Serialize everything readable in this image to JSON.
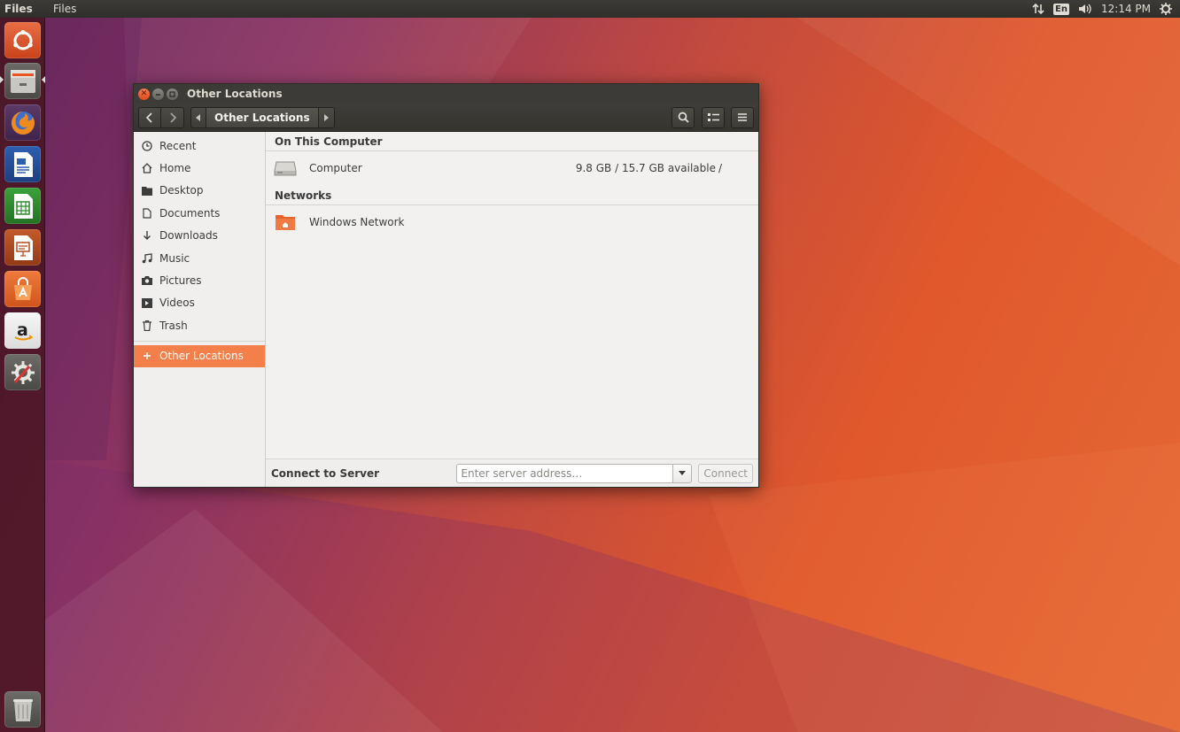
{
  "top_panel": {
    "app_name": "Files",
    "menu": "Files",
    "keyboard_layout": "En",
    "clock": "12:14 PM",
    "icons": [
      "network-transfer-icon",
      "keyboard-layout-icon",
      "volume-icon",
      "system-gear-icon"
    ]
  },
  "launcher": {
    "items": [
      {
        "name": "ubuntu-dash",
        "icon": "ubuntu-logo-icon",
        "color": "#e95420"
      },
      {
        "name": "files",
        "icon": "file-cabinet-icon",
        "color": "#b8b6b0"
      },
      {
        "name": "firefox",
        "icon": "firefox-icon",
        "color": "#e66000"
      },
      {
        "name": "libreoffice-writer",
        "icon": "writer-document-icon",
        "color": "#1e5aa8"
      },
      {
        "name": "libreoffice-calc",
        "icon": "calc-spreadsheet-icon",
        "color": "#2c8a2c"
      },
      {
        "name": "libreoffice-impress",
        "icon": "impress-presentation-icon",
        "color": "#b84a1c"
      },
      {
        "name": "ubuntu-software",
        "icon": "software-bag-icon",
        "color": "#e0672a"
      },
      {
        "name": "amazon",
        "icon": "amazon-icon",
        "color": "#f2f2f2"
      },
      {
        "name": "system-settings",
        "icon": "settings-gear-wrench-icon",
        "color": "#6a6a6a"
      },
      {
        "name": "trash",
        "icon": "trash-bin-icon",
        "color": "#7a7a7a"
      }
    ]
  },
  "window": {
    "title": "Other Locations",
    "pathbar": {
      "current": "Other Locations"
    },
    "sidebar": {
      "items": [
        {
          "label": "Recent",
          "icon": "clock-icon"
        },
        {
          "label": "Home",
          "icon": "home-icon"
        },
        {
          "label": "Desktop",
          "icon": "folder-icon"
        },
        {
          "label": "Documents",
          "icon": "document-icon"
        },
        {
          "label": "Downloads",
          "icon": "download-arrow-icon"
        },
        {
          "label": "Music",
          "icon": "music-note-icon"
        },
        {
          "label": "Pictures",
          "icon": "camera-icon"
        },
        {
          "label": "Videos",
          "icon": "film-icon"
        },
        {
          "label": "Trash",
          "icon": "trash-icon"
        }
      ],
      "other_locations": {
        "label": "Other Locations",
        "icon": "plus-icon"
      }
    },
    "main": {
      "on_this_computer": {
        "header": "On This Computer",
        "computer": {
          "name": "Computer",
          "space": "9.8 GB / 15.7 GB available",
          "mount": "/"
        }
      },
      "networks": {
        "header": "Networks",
        "windows_network": {
          "name": "Windows Network"
        }
      }
    },
    "connect": {
      "label": "Connect to Server",
      "placeholder": "Enter server address…",
      "button": "Connect"
    }
  },
  "colors": {
    "accent": "#f37f4b",
    "titlebar": "#3c3b37",
    "close_button": "#df4a16"
  }
}
